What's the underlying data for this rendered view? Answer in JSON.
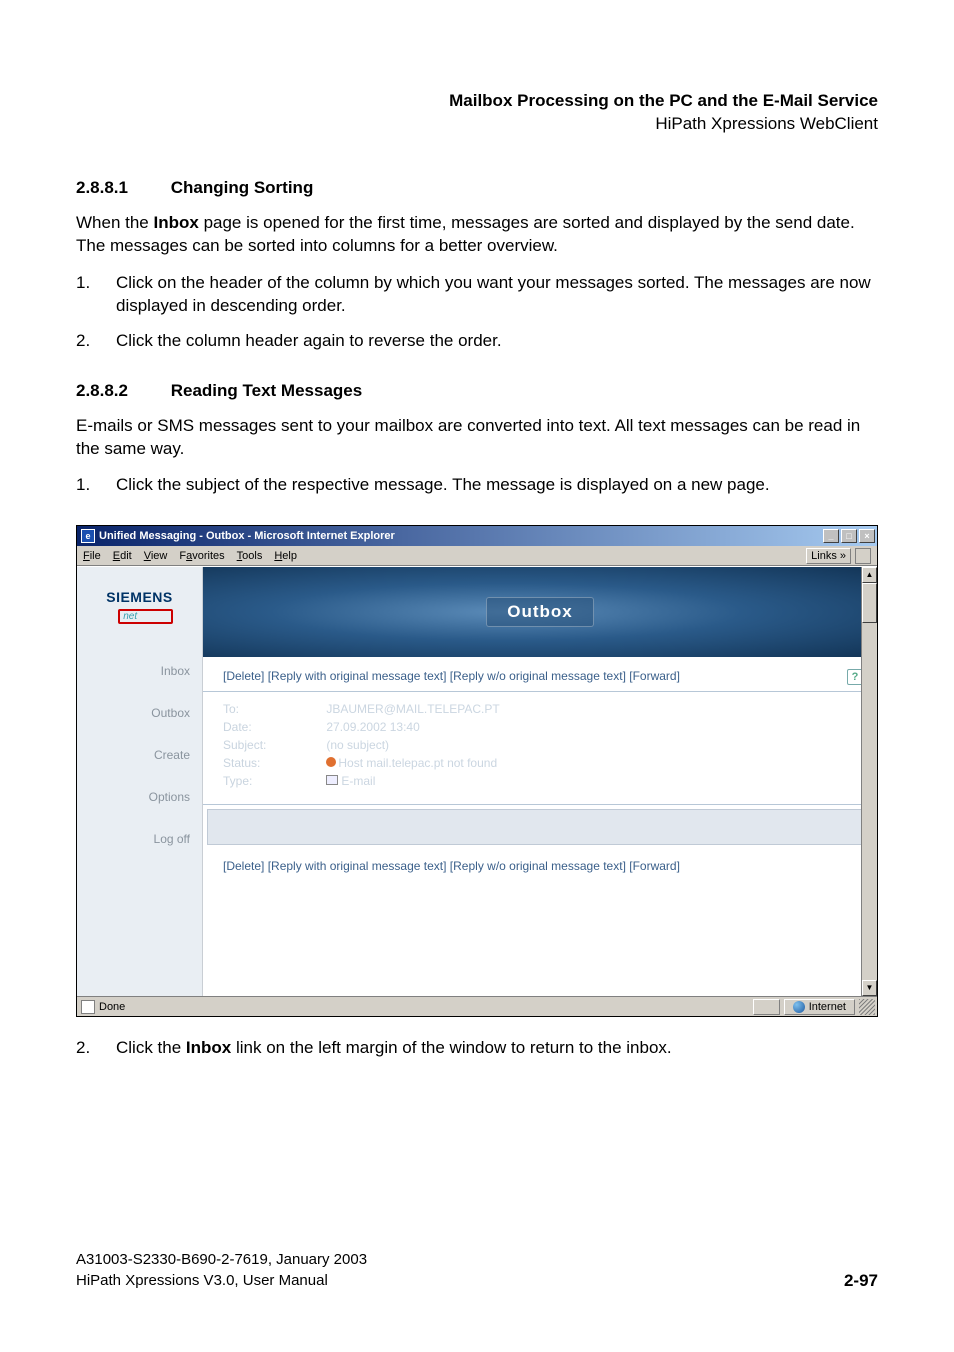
{
  "header": {
    "title": "Mailbox Processing on the PC and the E-Mail Service",
    "subtitle": "HiPath Xpressions WebClient"
  },
  "section1": {
    "num": "2.8.8.1",
    "title": "Changing Sorting",
    "para": "When the Inbox page is opened for the first time, messages are sorted and displayed by the send date. The messages can be sorted into columns for a better overview.",
    "inbox_bold": "Inbox",
    "para_pre": "When the ",
    "para_post": " page is opened for the first time, messages are sorted and displayed by the send date. The messages can be sorted into columns for a better overview.",
    "steps": [
      "Click on the header of the column by which you want your messages sorted. The messages are now displayed in descending order.",
      "Click the column header again to reverse the order."
    ]
  },
  "section2": {
    "num": "2.8.8.2",
    "title": "Reading Text Messages",
    "para": "E-mails or SMS messages sent to your mailbox are converted into text. All text messages can be read in the same way.",
    "steps": [
      "Click the subject of the respective message. The message is displayed on a new page."
    ]
  },
  "screenshot": {
    "window_title": "Unified Messaging - Outbox - Microsoft Internet Explorer",
    "menus": [
      "File",
      "Edit",
      "View",
      "Favorites",
      "Tools",
      "Help"
    ],
    "links_label": "Links »",
    "logo": "SIEMENS",
    "logo_net": "net",
    "nav": [
      "Inbox",
      "Outbox",
      "Create",
      "Options",
      "Log off"
    ],
    "banner": "Outbox",
    "actions": [
      "Delete",
      "Reply with original message text",
      "Reply w/o original message text",
      "Forward"
    ],
    "help_icon": "?",
    "msg": {
      "labels": [
        "To:",
        "Date:",
        "Subject:",
        "Status:",
        "Type:"
      ],
      "to": "JBAUMER@MAIL.TELEPAC.PT",
      "date": "27.09.2002 13:40",
      "subject": "(no subject)",
      "status": "Host mail.telepac.pt not found",
      "type": "E-mail"
    },
    "status_done": "Done",
    "status_zone": "Internet"
  },
  "after_shot": {
    "num": "2.",
    "pre": "Click the ",
    "bold": "Inbox",
    "post": " link on the left margin of the window to return to the inbox."
  },
  "footer": {
    "line1": "A31003-S2330-B690-2-7619, January 2003",
    "line2": "HiPath Xpressions V3.0, User Manual",
    "page": "2-97"
  }
}
